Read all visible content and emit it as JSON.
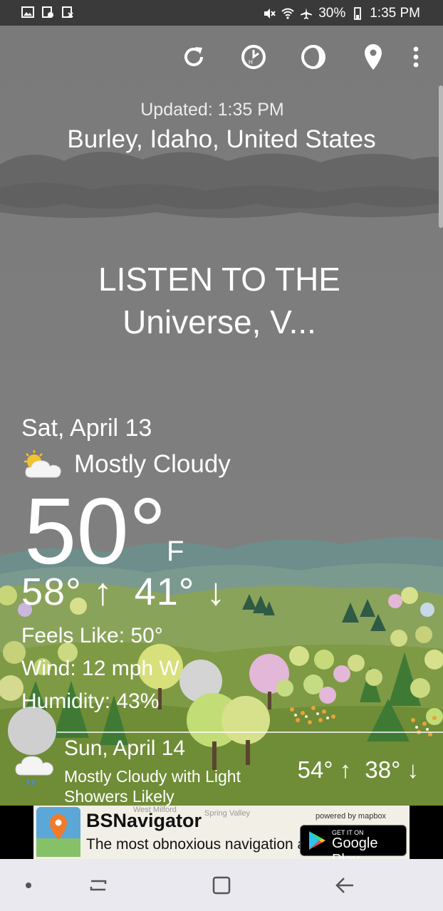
{
  "status_bar": {
    "battery": "30%",
    "time": "1:35 PM",
    "left_icons": [
      "gallery-icon",
      "screenshot-icon",
      "app-notification-icon"
    ],
    "right_icons": [
      "mute-icon",
      "wifi-icon",
      "airplane-icon",
      "battery-icon"
    ]
  },
  "toolbar": {
    "icons": [
      "refresh-icon",
      "history-icon",
      "moon-phase-icon",
      "location-pin-icon",
      "more-vert-icon"
    ]
  },
  "header": {
    "updated": "Updated: 1:35 PM",
    "location": "Burley, Idaho, United States"
  },
  "headline": {
    "line1": "LISTEN TO THE",
    "line2": "Universe, V..."
  },
  "current": {
    "date": "Sat, April 13",
    "condition": "Mostly Cloudy",
    "condition_icon": "partly-cloudy-icon",
    "temperature": "50°",
    "unit": "F",
    "high": "58°",
    "low": "41°",
    "feels_like": "Feels Like: 50°",
    "wind": "Wind: 12 mph W",
    "humidity": "Humidity: 43%"
  },
  "forecast": {
    "day": "Sun, April 14",
    "condition": "Mostly Cloudy with Light Showers Likely",
    "condition_icon": "cloud-rain-icon",
    "high": "54°",
    "low": "38°"
  },
  "ad": {
    "title": "BSNavigator",
    "subtitle": "The most obnoxious navigation app.",
    "map_label_1": "West Milford",
    "map_label_2": "Spring Valley",
    "powered_by": "powered by mapbox",
    "store_small": "GET IT ON",
    "store_big": "Google Play"
  },
  "nav_bar": {
    "icons": [
      "dot-icon",
      "recents-icon",
      "home-icon",
      "back-icon"
    ]
  },
  "colors": {
    "sky": "#7b7b7b",
    "status_bar": "#3a3a3a",
    "nav_bar": "#e9e9ef",
    "ad_bg": "#f1efe6",
    "text": "#ffffff"
  }
}
